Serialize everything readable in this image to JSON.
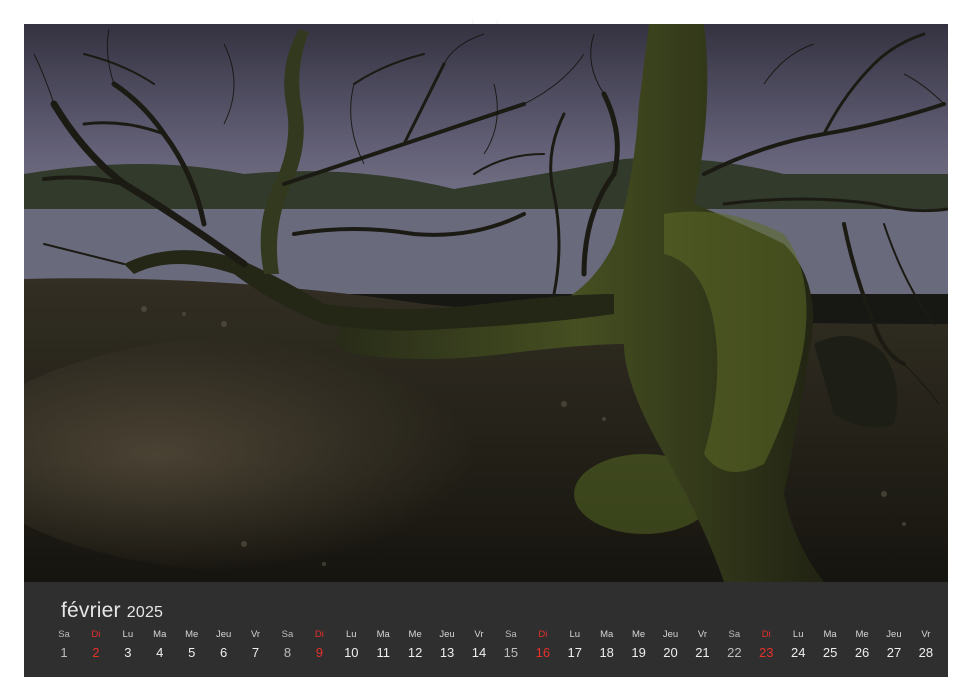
{
  "calendar": {
    "month": "février",
    "year": "2025",
    "colors": {
      "footer_bg": "#2f2f2f",
      "sunday": "#e6302a",
      "text": "#eeeeee"
    },
    "days": [
      {
        "dn": "Sa",
        "num": "1",
        "type": "sat"
      },
      {
        "dn": "Di",
        "num": "2",
        "type": "sun"
      },
      {
        "dn": "Lu",
        "num": "3",
        "type": "wd"
      },
      {
        "dn": "Ma",
        "num": "4",
        "type": "wd"
      },
      {
        "dn": "Me",
        "num": "5",
        "type": "wd"
      },
      {
        "dn": "Jeu",
        "num": "6",
        "type": "wd"
      },
      {
        "dn": "Vr",
        "num": "7",
        "type": "wd"
      },
      {
        "dn": "Sa",
        "num": "8",
        "type": "sat"
      },
      {
        "dn": "Di",
        "num": "9",
        "type": "sun"
      },
      {
        "dn": "Lu",
        "num": "10",
        "type": "wd"
      },
      {
        "dn": "Ma",
        "num": "11",
        "type": "wd"
      },
      {
        "dn": "Me",
        "num": "12",
        "type": "wd"
      },
      {
        "dn": "Jeu",
        "num": "13",
        "type": "wd"
      },
      {
        "dn": "Vr",
        "num": "14",
        "type": "wd"
      },
      {
        "dn": "Sa",
        "num": "15",
        "type": "sat"
      },
      {
        "dn": "Di",
        "num": "16",
        "type": "sun"
      },
      {
        "dn": "Lu",
        "num": "17",
        "type": "wd"
      },
      {
        "dn": "Ma",
        "num": "18",
        "type": "wd"
      },
      {
        "dn": "Me",
        "num": "19",
        "type": "wd"
      },
      {
        "dn": "Jeu",
        "num": "20",
        "type": "wd"
      },
      {
        "dn": "Vr",
        "num": "21",
        "type": "wd"
      },
      {
        "dn": "Sa",
        "num": "22",
        "type": "sat"
      },
      {
        "dn": "Di",
        "num": "23",
        "type": "sun"
      },
      {
        "dn": "Lu",
        "num": "24",
        "type": "wd"
      },
      {
        "dn": "Ma",
        "num": "25",
        "type": "wd"
      },
      {
        "dn": "Me",
        "num": "26",
        "type": "wd"
      },
      {
        "dn": "Jeu",
        "num": "27",
        "type": "wd"
      },
      {
        "dn": "Vr",
        "num": "28",
        "type": "wd"
      }
    ]
  },
  "photo": {
    "subject": "gnarled-mossy-tree-lakeshore-photo"
  }
}
